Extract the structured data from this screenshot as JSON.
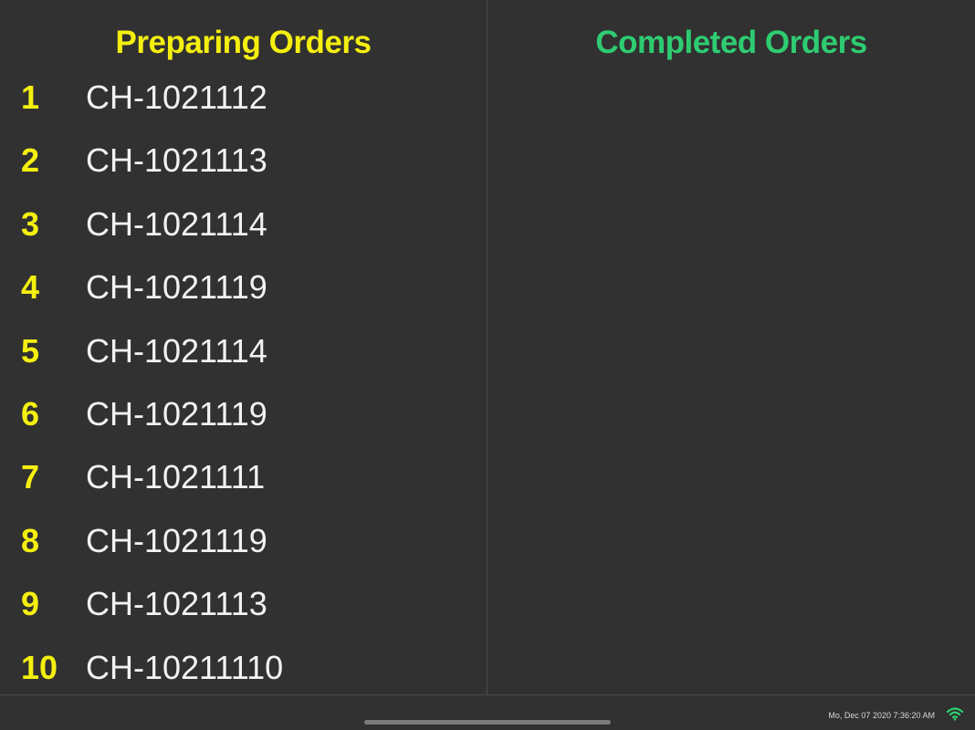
{
  "preparing": {
    "title": "Preparing Orders",
    "orders": [
      {
        "position": "1",
        "id": "CH-1021112"
      },
      {
        "position": "2",
        "id": "CH-1021113"
      },
      {
        "position": "3",
        "id": "CH-1021114"
      },
      {
        "position": "4",
        "id": "CH-1021119"
      },
      {
        "position": "5",
        "id": "CH-1021114"
      },
      {
        "position": "6",
        "id": "CH-1021119"
      },
      {
        "position": "7",
        "id": "CH-1021111"
      },
      {
        "position": "8",
        "id": "CH-1021119"
      },
      {
        "position": "9",
        "id": "CH-1021113"
      },
      {
        "position": "10",
        "id": "CH-10211110"
      }
    ]
  },
  "completed": {
    "title": "Completed Orders",
    "orders": []
  },
  "status_bar": {
    "timestamp": "Mo, Dec 07 2020 7:36:20 AM",
    "wifi_icon": "wifi-icon"
  },
  "colors": {
    "background": "#313131",
    "preparing_accent": "#f5ef10",
    "completed_accent": "#2ecc71",
    "order_text": "#f2f2f2"
  }
}
